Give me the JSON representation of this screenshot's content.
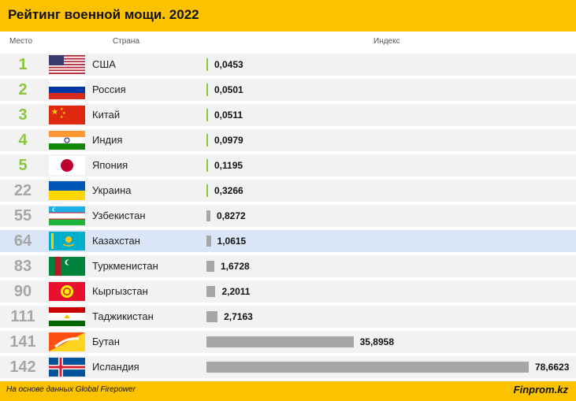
{
  "header": {
    "title": "Рейтинг военной мощи. 2022"
  },
  "columns": {
    "rank": "Место",
    "country": "Страна",
    "index": "Индекс"
  },
  "footer": {
    "source": "На основе данных Global Firepower",
    "brand": "Finprom.kz"
  },
  "colors": {
    "accent": "#fcc200",
    "top_rank": "#8cc63f",
    "other_rank": "#a6a6a6",
    "bar": "#a6a6a6",
    "bar_top": "#8cc63f",
    "highlight_row": "#dae6f8"
  },
  "chart_data": {
    "type": "bar",
    "orientation": "horizontal",
    "categories": [
      "США",
      "Россия",
      "Китай",
      "Индия",
      "Япония",
      "Украина",
      "Узбекистан",
      "Казахстан",
      "Туркменистан",
      "Кыргызстан",
      "Таджикистан",
      "Бутан",
      "Исландия"
    ],
    "ranks": [
      "1",
      "2",
      "3",
      "4",
      "5",
      "22",
      "55",
      "64",
      "83",
      "90",
      "111",
      "141",
      "142"
    ],
    "values": [
      0.0453,
      0.0501,
      0.0511,
      0.0979,
      0.1195,
      0.3266,
      0.8272,
      1.0615,
      1.6728,
      2.2011,
      2.7163,
      35.8958,
      78.6623
    ],
    "value_labels": [
      "0,0453",
      "0,0501",
      "0,0511",
      "0,0979",
      "0,1195",
      "0,3266",
      "0,8272",
      "1,0615",
      "1,6728",
      "2,2011",
      "2,7163",
      "35,8958",
      "78,6623"
    ],
    "flags": [
      "usa-flag",
      "russia-flag",
      "china-flag",
      "india-flag",
      "japan-flag",
      "ukraine-flag",
      "uzbekistan-flag",
      "kazakhstan-flag",
      "turkmenistan-flag",
      "kyrgyzstan-flag",
      "tajikistan-flag",
      "bhutan-flag",
      "iceland-flag"
    ],
    "highlight": "Казахстан",
    "xlim": [
      0,
      78.6623
    ]
  }
}
